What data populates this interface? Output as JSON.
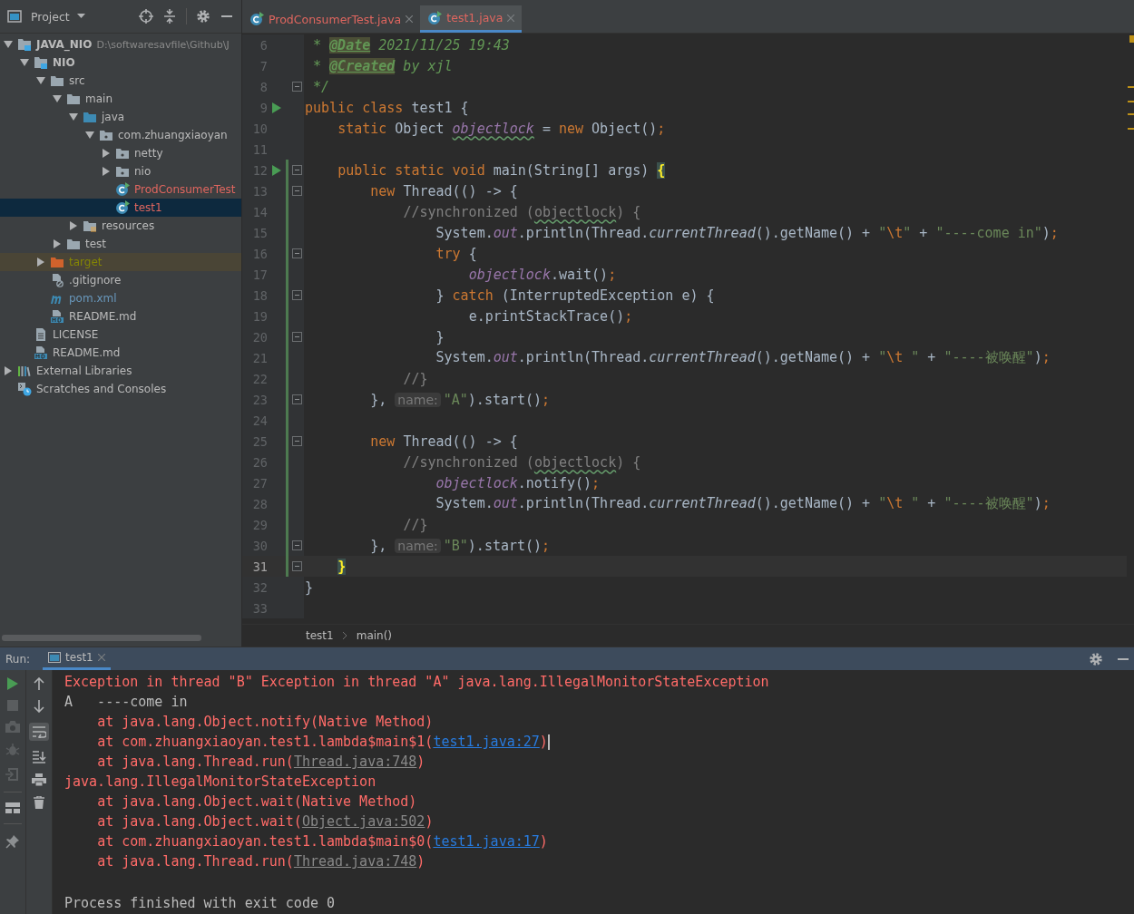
{
  "project_panel": {
    "title": "Project",
    "tree": [
      {
        "label": "JAVA_NIO",
        "path": "D:\\softwaresavfile\\Github\\J",
        "kind": "module",
        "expanded": true,
        "selected": false,
        "children": [
          {
            "label": "NIO",
            "kind": "module",
            "expanded": true,
            "selected": false,
            "children": [
              {
                "label": "src",
                "kind": "folder",
                "expanded": true,
                "selected": false,
                "children": [
                  {
                    "label": "main",
                    "kind": "folder",
                    "expanded": true,
                    "selected": false,
                    "children": [
                      {
                        "label": "java",
                        "kind": "source-folder",
                        "expanded": true,
                        "selected": false,
                        "children": [
                          {
                            "label": "com.zhuangxiaoyan",
                            "kind": "package",
                            "expanded": true,
                            "selected": false,
                            "children": [
                              {
                                "label": "netty",
                                "kind": "package",
                                "expanded": false,
                                "selected": false
                              },
                              {
                                "label": "nio",
                                "kind": "package",
                                "expanded": false,
                                "selected": false
                              },
                              {
                                "label": "ProdConsumerTest",
                                "kind": "class",
                                "color": "#e0665f",
                                "selected": false
                              },
                              {
                                "label": "test1",
                                "kind": "class",
                                "color": "#e0665f",
                                "selected": true
                              }
                            ]
                          }
                        ]
                      },
                      {
                        "label": "resources",
                        "kind": "resources",
                        "expanded": false,
                        "selected": false
                      }
                    ]
                  },
                  {
                    "label": "test",
                    "kind": "folder",
                    "expanded": false,
                    "selected": false
                  }
                ]
              },
              {
                "label": "target",
                "kind": "excluded",
                "color": "#848504",
                "expanded": false,
                "selected": false
              },
              {
                "label": ".gitignore",
                "kind": "ignore-file",
                "selected": false
              },
              {
                "label": "pom.xml",
                "kind": "maven",
                "color": "#6897bb",
                "selected": false
              },
              {
                "label": "README.md",
                "kind": "markdown",
                "selected": false
              }
            ]
          },
          {
            "label": "LICENSE",
            "kind": "text-file",
            "selected": false
          },
          {
            "label": "README.md",
            "kind": "markdown",
            "selected": false
          }
        ]
      },
      {
        "label": "External Libraries",
        "kind": "libraries",
        "expanded": false,
        "selected": false
      },
      {
        "label": "Scratches and Consoles",
        "kind": "scratches",
        "selected": false
      }
    ]
  },
  "editor": {
    "tabs": [
      {
        "label": "ProdConsumerTest.java",
        "color": "#e0665f",
        "selected": false
      },
      {
        "label": "test1.java",
        "color": "#e0665f",
        "selected": true
      }
    ],
    "lines": [
      {
        "number": "6",
        "run": false,
        "fold": false,
        "changed": false,
        "current": false,
        "tokens": [
          {
            "kind": "doc",
            "text": " * "
          },
          {
            "kind": "tag",
            "text": "@Date"
          },
          {
            "kind": "doc",
            "text": " 2021/11/25 19:43"
          }
        ]
      },
      {
        "number": "7",
        "run": false,
        "fold": false,
        "changed": false,
        "current": false,
        "tokens": [
          {
            "kind": "doc",
            "text": " * "
          },
          {
            "kind": "tag",
            "text": "@Created"
          },
          {
            "kind": "doc",
            "text": " by xjl"
          }
        ]
      },
      {
        "number": "8",
        "run": false,
        "fold": true,
        "changed": false,
        "current": false,
        "tokens": [
          {
            "kind": "doc",
            "text": " */"
          }
        ]
      },
      {
        "number": "9",
        "run": true,
        "fold": false,
        "changed": false,
        "current": false,
        "tokens": [
          {
            "kind": "kw",
            "text": "public class "
          },
          {
            "kind": "txt",
            "text": "test1 {"
          }
        ]
      },
      {
        "number": "10",
        "run": false,
        "fold": false,
        "changed": false,
        "current": false,
        "tokens": [
          {
            "kind": "kw",
            "text": "    static "
          },
          {
            "kind": "txt",
            "text": "Object "
          },
          {
            "kind": "field",
            "text": "objectlock",
            "spell": true
          },
          {
            "kind": "txt",
            "text": " = "
          },
          {
            "kind": "kw",
            "text": "new "
          },
          {
            "kind": "txt",
            "text": "Object()"
          },
          {
            "kind": "kw",
            "text": ";"
          }
        ]
      },
      {
        "number": "11",
        "run": false,
        "fold": false,
        "changed": false,
        "current": false
      },
      {
        "number": "12",
        "run": true,
        "fold": true,
        "changed": true,
        "current": false,
        "tokens": [
          {
            "kind": "kw",
            "text": "    public static void "
          },
          {
            "kind": "txt",
            "text": "main(String[] args) "
          },
          {
            "kind": "brace",
            "text": "{"
          }
        ]
      },
      {
        "number": "13",
        "run": false,
        "fold": true,
        "changed": true,
        "current": false,
        "tokens": [
          {
            "kind": "kw",
            "text": "        new "
          },
          {
            "kind": "txt",
            "text": "Thread(() -> {"
          }
        ]
      },
      {
        "number": "14",
        "run": false,
        "fold": false,
        "changed": true,
        "current": false,
        "tokens": [
          {
            "kind": "cmt",
            "text": "            //synchronized ("
          },
          {
            "kind": "cmt",
            "text": "objectlock",
            "spell": true
          },
          {
            "kind": "cmt",
            "text": ") {"
          }
        ]
      },
      {
        "number": "15",
        "run": false,
        "fold": false,
        "changed": true,
        "current": false,
        "tokens": [
          {
            "kind": "txt",
            "text": "                System."
          },
          {
            "kind": "field",
            "text": "out"
          },
          {
            "kind": "txt",
            "text": ".println(Thread."
          },
          {
            "kind": "static",
            "text": "currentThread"
          },
          {
            "kind": "txt",
            "text": "().getName() + "
          },
          {
            "kind": "str",
            "text": "\""
          },
          {
            "kind": "kw",
            "text": "\\t"
          },
          {
            "kind": "str",
            "text": "\""
          },
          {
            "kind": "txt",
            "text": " + "
          },
          {
            "kind": "str",
            "text": "\"----come in\""
          },
          {
            "kind": "txt",
            "text": ")"
          },
          {
            "kind": "kw",
            "text": ";"
          }
        ]
      },
      {
        "number": "16",
        "run": false,
        "fold": true,
        "changed": true,
        "current": false,
        "tokens": [
          {
            "kind": "kw",
            "text": "                try "
          },
          {
            "kind": "txt",
            "text": "{"
          }
        ]
      },
      {
        "number": "17",
        "run": false,
        "fold": false,
        "changed": true,
        "current": false,
        "tokens": [
          {
            "kind": "field",
            "text": "                    objectlock"
          },
          {
            "kind": "txt",
            "text": ".wait()"
          },
          {
            "kind": "kw",
            "text": ";"
          }
        ]
      },
      {
        "number": "18",
        "run": false,
        "fold": true,
        "changed": true,
        "current": false,
        "tokens": [
          {
            "kind": "txt",
            "text": "                } "
          },
          {
            "kind": "kw",
            "text": "catch "
          },
          {
            "kind": "txt",
            "text": "(InterruptedException e) {"
          }
        ]
      },
      {
        "number": "19",
        "run": false,
        "fold": false,
        "changed": true,
        "current": false,
        "tokens": [
          {
            "kind": "txt",
            "text": "                    e.printStackTrace()"
          },
          {
            "kind": "kw",
            "text": ";"
          }
        ]
      },
      {
        "number": "20",
        "run": false,
        "fold": true,
        "changed": true,
        "current": false,
        "tokens": [
          {
            "kind": "txt",
            "text": "                }"
          }
        ]
      },
      {
        "number": "21",
        "run": false,
        "fold": false,
        "changed": true,
        "current": false,
        "tokens": [
          {
            "kind": "txt",
            "text": "                System."
          },
          {
            "kind": "field",
            "text": "out"
          },
          {
            "kind": "txt",
            "text": ".println(Thread."
          },
          {
            "kind": "static",
            "text": "currentThread"
          },
          {
            "kind": "txt",
            "text": "().getName() + "
          },
          {
            "kind": "str",
            "text": "\""
          },
          {
            "kind": "kw",
            "text": "\\t"
          },
          {
            "kind": "str",
            "text": " \""
          },
          {
            "kind": "txt",
            "text": " + "
          },
          {
            "kind": "str",
            "text": "\"----被唤醒\""
          },
          {
            "kind": "txt",
            "text": ")"
          },
          {
            "kind": "kw",
            "text": ";"
          }
        ]
      },
      {
        "number": "22",
        "run": false,
        "fold": false,
        "changed": true,
        "current": false,
        "tokens": [
          {
            "kind": "cmt",
            "text": "            //}"
          }
        ]
      },
      {
        "number": "23",
        "run": false,
        "fold": true,
        "changed": true,
        "current": false,
        "tokens": [
          {
            "kind": "txt",
            "text": "        },"
          },
          {
            "kind": "hint",
            "text": "name:"
          },
          {
            "kind": "str",
            "text": "\"A\""
          },
          {
            "kind": "txt",
            "text": ").start()"
          },
          {
            "kind": "kw",
            "text": ";"
          }
        ]
      },
      {
        "number": "24",
        "run": false,
        "fold": false,
        "changed": true,
        "current": false
      },
      {
        "number": "25",
        "run": false,
        "fold": true,
        "changed": true,
        "current": false,
        "tokens": [
          {
            "kind": "kw",
            "text": "        new "
          },
          {
            "kind": "txt",
            "text": "Thread(() -> {"
          }
        ]
      },
      {
        "number": "26",
        "run": false,
        "fold": false,
        "changed": true,
        "current": false,
        "tokens": [
          {
            "kind": "cmt",
            "text": "            //synchronized ("
          },
          {
            "kind": "cmt",
            "text": "objectlock",
            "spell": true
          },
          {
            "kind": "cmt",
            "text": ") {"
          }
        ]
      },
      {
        "number": "27",
        "run": false,
        "fold": false,
        "changed": true,
        "current": false,
        "tokens": [
          {
            "kind": "field",
            "text": "                objectlock"
          },
          {
            "kind": "txt",
            "text": ".notify()"
          },
          {
            "kind": "kw",
            "text": ";"
          }
        ]
      },
      {
        "number": "28",
        "run": false,
        "fold": false,
        "changed": true,
        "current": false,
        "tokens": [
          {
            "kind": "txt",
            "text": "                System."
          },
          {
            "kind": "field",
            "text": "out"
          },
          {
            "kind": "txt",
            "text": ".println(Thread."
          },
          {
            "kind": "static",
            "text": "currentThread"
          },
          {
            "kind": "txt",
            "text": "().getName() + "
          },
          {
            "kind": "str",
            "text": "\""
          },
          {
            "kind": "kw",
            "text": "\\t"
          },
          {
            "kind": "str",
            "text": " \""
          },
          {
            "kind": "txt",
            "text": " + "
          },
          {
            "kind": "str",
            "text": "\"----被唤醒\""
          },
          {
            "kind": "txt",
            "text": ")"
          },
          {
            "kind": "kw",
            "text": ";"
          }
        ]
      },
      {
        "number": "29",
        "run": false,
        "fold": false,
        "changed": true,
        "current": false,
        "tokens": [
          {
            "kind": "cmt",
            "text": "            //}"
          }
        ]
      },
      {
        "number": "30",
        "run": false,
        "fold": true,
        "changed": true,
        "current": false,
        "tokens": [
          {
            "kind": "txt",
            "text": "        },"
          },
          {
            "kind": "hint",
            "text": "name:"
          },
          {
            "kind": "str",
            "text": "\"B\""
          },
          {
            "kind": "txt",
            "text": ").start()"
          },
          {
            "kind": "kw",
            "text": ";"
          }
        ]
      },
      {
        "number": "31",
        "run": false,
        "fold": true,
        "changed": true,
        "current": true,
        "tokens": [
          {
            "kind": "brace",
            "text": "    }"
          }
        ]
      },
      {
        "number": "32",
        "run": false,
        "fold": false,
        "changed": false,
        "current": false,
        "tokens": [
          {
            "kind": "txt",
            "text": "}"
          }
        ]
      },
      {
        "number": "33",
        "run": false,
        "fold": false,
        "changed": false,
        "current": false
      }
    ],
    "breadcrumbs": [
      "test1",
      "main()"
    ]
  },
  "run_panel": {
    "label": "Run:",
    "tabs": [
      {
        "label": "test1",
        "selected": true
      }
    ],
    "console": [
      {
        "kind": "err",
        "cursor": false,
        "parts": [
          {
            "kind": "text",
            "text": "Exception in thread \"B\" Exception in thread \"A\" java.lang.IllegalMonitorStateException"
          }
        ]
      },
      {
        "kind": "out",
        "cursor": false,
        "parts": [
          {
            "kind": "text",
            "text": "A   ----come in"
          }
        ]
      },
      {
        "kind": "err",
        "cursor": false,
        "parts": [
          {
            "kind": "text",
            "text": "    at java.lang.Object.notify(Native Method)"
          }
        ]
      },
      {
        "kind": "err",
        "cursor": true,
        "parts": [
          {
            "kind": "text",
            "text": "    at com.zhuangxiaoyan.test1.lambda$main$1("
          },
          {
            "kind": "link",
            "text": "test1.java:27"
          },
          {
            "kind": "text",
            "text": ")"
          }
        ]
      },
      {
        "kind": "err",
        "cursor": false,
        "parts": [
          {
            "kind": "text",
            "text": "    at java.lang.Thread.run("
          },
          {
            "kind": "lib",
            "text": "Thread.java:748"
          },
          {
            "kind": "text",
            "text": ")"
          }
        ]
      },
      {
        "kind": "err",
        "cursor": false,
        "parts": [
          {
            "kind": "text",
            "text": "java.lang.IllegalMonitorStateException"
          }
        ]
      },
      {
        "kind": "err",
        "cursor": false,
        "parts": [
          {
            "kind": "text",
            "text": "    at java.lang.Object.wait(Native Method)"
          }
        ]
      },
      {
        "kind": "err",
        "cursor": false,
        "parts": [
          {
            "kind": "text",
            "text": "    at java.lang.Object.wait("
          },
          {
            "kind": "lib",
            "text": "Object.java:502"
          },
          {
            "kind": "text",
            "text": ")"
          }
        ]
      },
      {
        "kind": "err",
        "cursor": false,
        "parts": [
          {
            "kind": "text",
            "text": "    at com.zhuangxiaoyan.test1.lambda$main$0("
          },
          {
            "kind": "link",
            "text": "test1.java:17"
          },
          {
            "kind": "text",
            "text": ")"
          }
        ]
      },
      {
        "kind": "err",
        "cursor": false,
        "parts": [
          {
            "kind": "text",
            "text": "    at java.lang.Thread.run("
          },
          {
            "kind": "lib",
            "text": "Thread.java:748"
          },
          {
            "kind": "text",
            "text": ")"
          }
        ]
      },
      {
        "kind": "blank",
        "cursor": false
      },
      {
        "kind": "out",
        "cursor": false,
        "parts": [
          {
            "kind": "text",
            "text": "Process finished with exit code 0"
          }
        ]
      }
    ]
  }
}
